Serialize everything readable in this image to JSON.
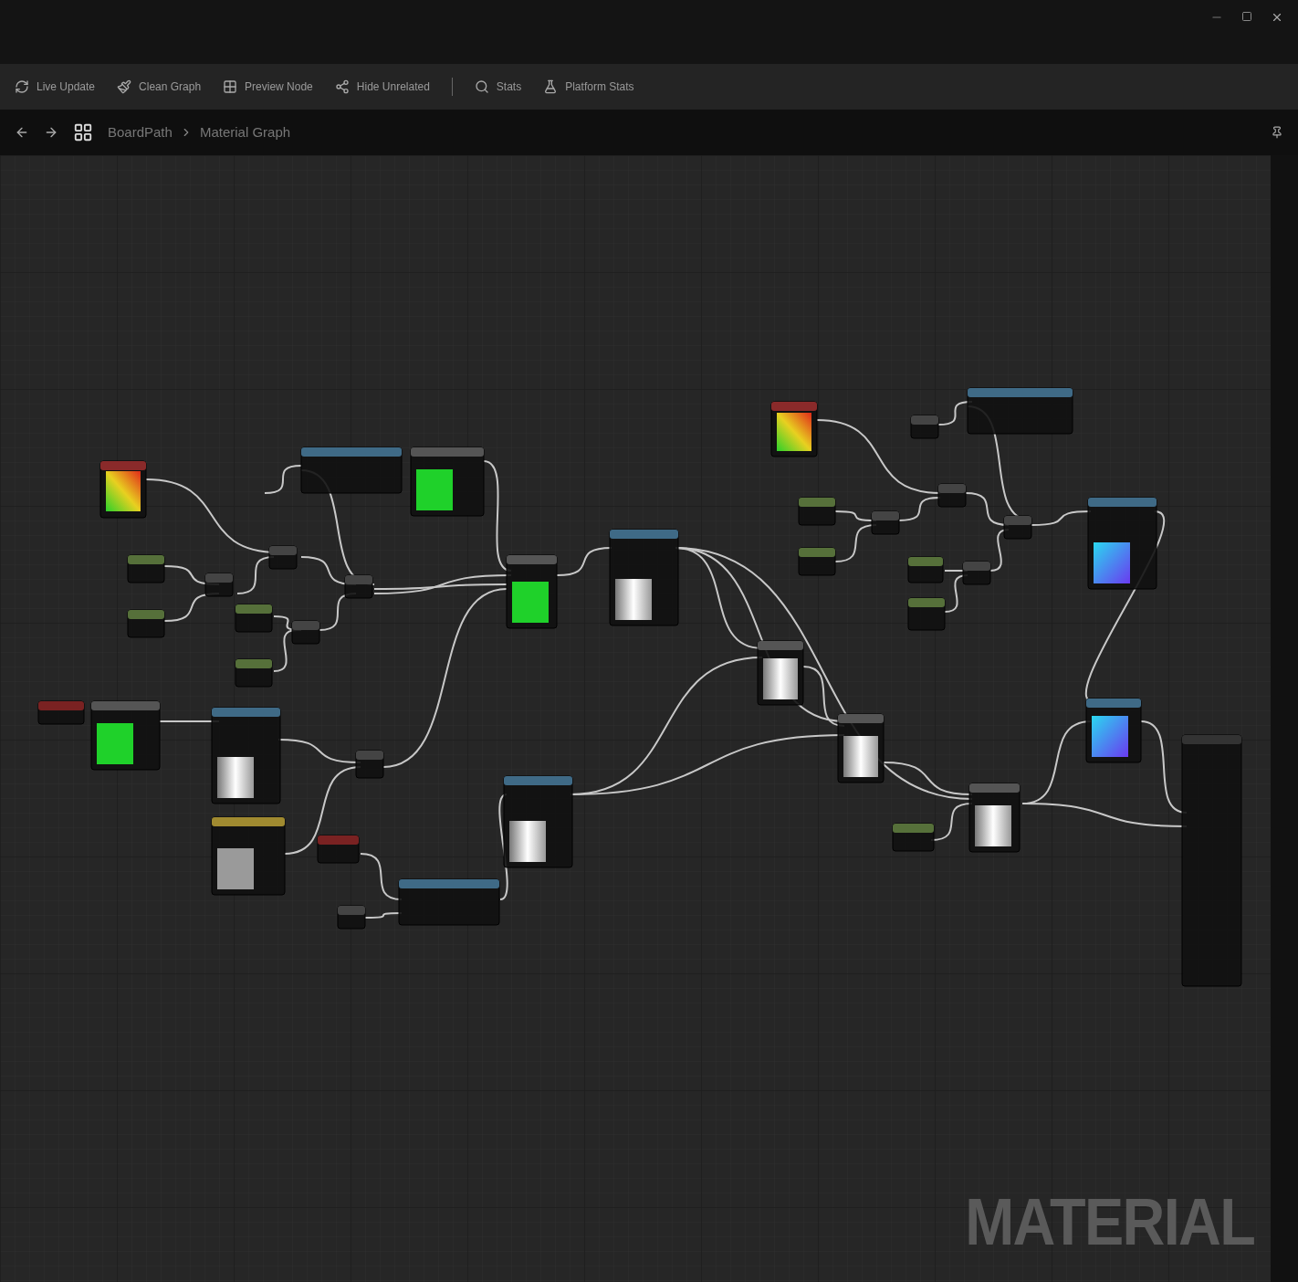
{
  "toolbar": {
    "buttons": [
      {
        "label": "Live Update"
      },
      {
        "label": "Clean Graph"
      },
      {
        "label": "Preview Node"
      },
      {
        "label": "Hide Unrelated"
      },
      {
        "label": "Stats"
      },
      {
        "label": "Platform Stats"
      }
    ]
  },
  "breadcrumb": {
    "items": [
      "BoardPath",
      "Material Graph"
    ]
  },
  "graph": {
    "watermark": "MATERIAL"
  }
}
